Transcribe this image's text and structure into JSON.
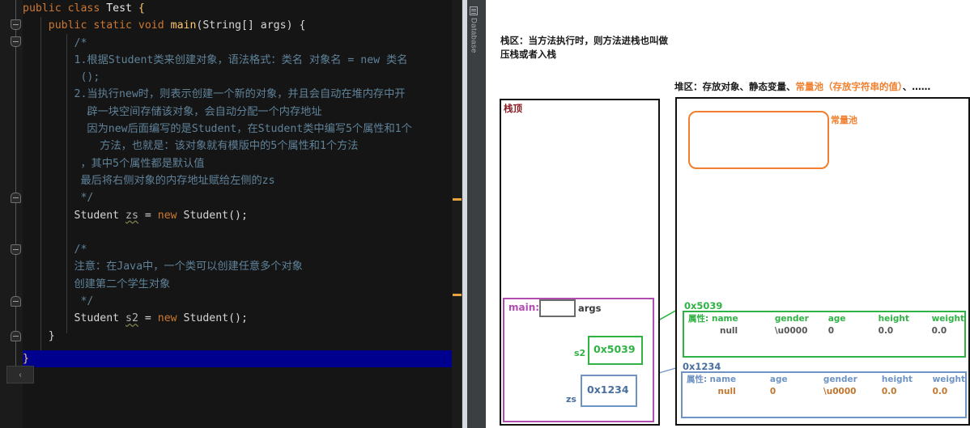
{
  "editor": {
    "lines": [
      [
        {
          "t": "public ",
          "c": "kw"
        },
        {
          "t": "class ",
          "c": "kw"
        },
        {
          "t": "Test ",
          "c": "cls"
        },
        {
          "t": "{",
          "c": "brc"
        }
      ],
      [
        {
          "t": "    ",
          "c": "pln"
        },
        {
          "t": "public static void ",
          "c": "kw"
        },
        {
          "t": "main",
          "c": "mth"
        },
        {
          "t": "(",
          "c": "pln"
        },
        {
          "t": "String[] args",
          "c": "pln"
        },
        {
          "t": ") {",
          "c": "pln"
        }
      ],
      [
        {
          "t": "        /*",
          "c": "cmt"
        }
      ],
      [
        {
          "t": "        1.根据Student类来创建对象，语法格式：类名 对象名 = new 类名",
          "c": "cmt"
        }
      ],
      [
        {
          "t": "         ();",
          "c": "cmt"
        }
      ],
      [
        {
          "t": "        2.当执行new时，则表示创建一个新的对象，并且会自动在堆内存中开",
          "c": "cmt"
        }
      ],
      [
        {
          "t": "          辟一块空间存储该对象，会自动分配一个内存地址",
          "c": "cmt"
        }
      ],
      [
        {
          "t": "          因为new后面编写的是Student，在Student类中编写5个属性和1个",
          "c": "cmt"
        }
      ],
      [
        {
          "t": "            方法，也就是：该对象就有模版中的5个属性和1个方法",
          "c": "cmt"
        }
      ],
      [
        {
          "t": "         ，其中5个属性都是默认值",
          "c": "cmt"
        }
      ],
      [
        {
          "t": "         最后将右侧对象的内存地址赋给左侧的zs",
          "c": "cmt"
        }
      ],
      [
        {
          "t": "         */",
          "c": "cmt"
        }
      ],
      [
        {
          "t": "        Student ",
          "c": "pln"
        },
        {
          "t": "zs",
          "c": "var"
        },
        {
          "t": " = ",
          "c": "pln"
        },
        {
          "t": "new",
          "c": "kw"
        },
        {
          "t": " Student();",
          "c": "pln"
        }
      ],
      [
        {
          "t": "",
          "c": "pln"
        }
      ],
      [
        {
          "t": "        /*",
          "c": "cmt"
        }
      ],
      [
        {
          "t": "        注意：在Java中，一个类可以创建任意多个对象",
          "c": "cmt"
        }
      ],
      [
        {
          "t": "        创建第二个学生对象",
          "c": "cmt"
        }
      ],
      [
        {
          "t": "         */",
          "c": "cmt"
        }
      ],
      [
        {
          "t": "        Student ",
          "c": "pln"
        },
        {
          "t": "s2",
          "c": "var"
        },
        {
          "t": " = ",
          "c": "pln"
        },
        {
          "t": "new",
          "c": "kw"
        },
        {
          "t": " Student();",
          "c": "pln"
        }
      ],
      [
        {
          "t": "    }",
          "c": "pln"
        }
      ]
    ],
    "caret_line_text": "}",
    "breadcrumb": "‹",
    "toolstrip": {
      "database_label": "Database"
    }
  },
  "diagram": {
    "stack_note": "栈区：当方法执行时，则方法进栈也叫做\n压栈或者入栈",
    "stack_top_label": "栈顶",
    "heap_title_prefix": "堆区：存放对象、静态变量、",
    "heap_title_accent": "常量池（存放字符串的值）",
    "heap_title_suffix": "、……",
    "pool_label": "常量池",
    "frame": {
      "name": "main:",
      "args_label": "args",
      "vars": [
        {
          "name": "s2",
          "value": "0x5039",
          "color": "green"
        },
        {
          "name": "zs",
          "value": "0x1234",
          "color": "blue"
        }
      ]
    },
    "objects": [
      {
        "address": "0x5039",
        "color": "green",
        "attr_label": "属性:",
        "headers": [
          "name",
          "gender",
          "age",
          "height",
          "weight"
        ],
        "values": [
          "null",
          "\\u0000",
          "0",
          "0.0",
          "0.0"
        ]
      },
      {
        "address": "0x1234",
        "color": "blue",
        "attr_label": "属性:",
        "headers": [
          "name",
          "age",
          "gender",
          "height",
          "weight"
        ],
        "values": [
          "null",
          "0",
          "\\u0000",
          "0.0",
          "0.0"
        ]
      }
    ]
  },
  "colors": {
    "green": "#2fb344",
    "blue": "#6f94c4",
    "purple": "#b14cb1",
    "orange": "#f08030",
    "dark_red": "#8b1c24",
    "caret_line": "#00008f"
  }
}
